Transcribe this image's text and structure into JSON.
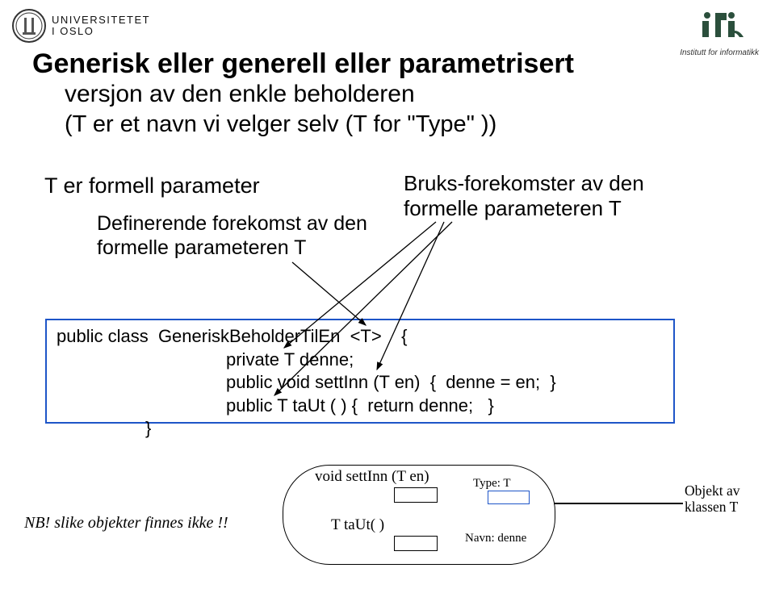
{
  "header": {
    "uio_line1": "UNIVERSITETET",
    "uio_line2": "I OSLO",
    "ifi_caption": "Institutt for informatikk"
  },
  "title": "Generisk eller generell eller parametrisert",
  "subtitle": "versjon av den enkle beholderen",
  "subtitle2": "(T  er et navn vi velger selv (T for \"Type\" ))",
  "left_label": "T er formell parameter",
  "defining_label": "Definerende forekomst av den\nformelle parameteren T",
  "bruks_label": "Bruks-forekomster av den\nformelle parameteren T",
  "code": {
    "l1": "public class  GeneriskBeholderTilEn  <T>    {",
    "l2": "private T denne;",
    "l3": "public void settInn (T en)  {  denne = en;  }",
    "l4": "public T taUt ( ) {  return denne;   }",
    "lclose": "}"
  },
  "nb": "NB! slike objekter finnes ikke !!",
  "diagram": {
    "m1": "void settInn (T   en)",
    "m2": "T  taUt( )",
    "type": "Type:  T",
    "navn": "Navn:  denne",
    "objekt": "Objekt av\nklassen T"
  }
}
